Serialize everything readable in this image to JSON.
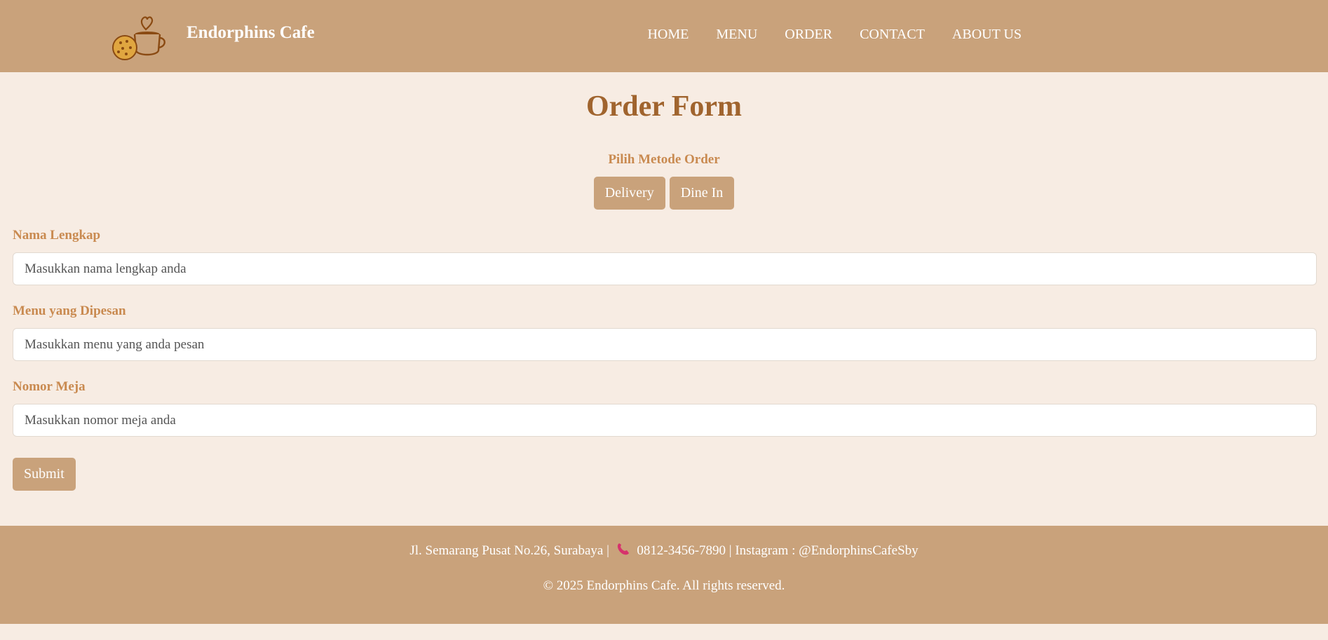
{
  "header": {
    "brand": "Endorphins Cafe",
    "nav": [
      "HOME",
      "MENU",
      "ORDER",
      "CONTACT",
      "ABOUT US"
    ]
  },
  "main": {
    "title": "Order Form",
    "method_label": "Pilih Metode Order",
    "method_buttons": [
      "Delivery",
      "Dine In"
    ],
    "fields": [
      {
        "label": "Nama Lengkap",
        "placeholder": "Masukkan nama lengkap anda",
        "value": ""
      },
      {
        "label": "Menu yang Dipesan",
        "placeholder": "Masukkan menu yang anda pesan",
        "value": ""
      },
      {
        "label": "Nomor Meja",
        "placeholder": "Masukkan nomor meja anda",
        "value": ""
      }
    ],
    "submit_label": "Submit"
  },
  "footer": {
    "address": "Jl. Semarang Pusat No.26, Surabaya |",
    "phone": "0812-3456-7890 | Instagram : @EndorphinsCafeSby",
    "copyright": "© 2025 Endorphins Cafe. All rights reserved."
  },
  "icons": {
    "logo": "coffee-cup-cookie-icon",
    "phone": "telephone-receiver-icon"
  },
  "colors": {
    "header_bg": "#c9a27b",
    "page_bg": "#f7ece3",
    "title": "#a0642e",
    "label": "#c98a50",
    "button_bg": "#c9a27b"
  }
}
